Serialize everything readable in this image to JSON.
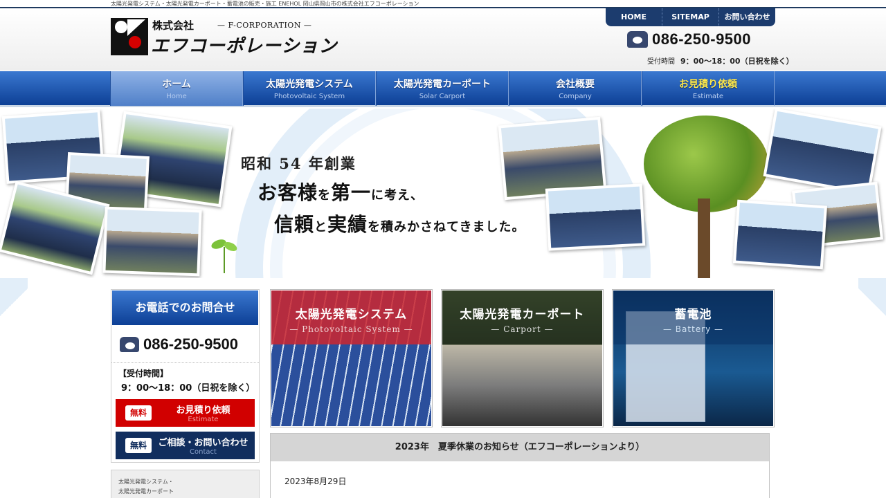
{
  "top_strip": {
    "text": "太陽光発電システム・太陽光発電カーポート・蓄電池の販売・施工 ENEHOL 岡山県岡山市の株式会社エフコーポレーション"
  },
  "header": {
    "logo_kabushiki": "株式会社",
    "logo_english": "— F-CORPORATION —",
    "logo_name": "エフコーポレーション",
    "utility_nav": [
      "HOME",
      "SITEMAP",
      "お問い合わせ"
    ],
    "phone": "086-250-9500",
    "hours_label": "受付時間",
    "hours": "9：00～18：00（日祝を除く）"
  },
  "nav": [
    {
      "jp": "ホーム",
      "en": "Home"
    },
    {
      "jp": "太陽光発電システム",
      "en": "Photovoltaic System"
    },
    {
      "jp": "太陽光発電カーポート",
      "en": "Solar Carport"
    },
    {
      "jp": "会社概要",
      "en": "Company"
    },
    {
      "jp": "お見積り依頼",
      "en": "Estimate"
    }
  ],
  "hero": {
    "line1": "昭和 54 年創業",
    "line2_a": "お客様",
    "line2_b": "を",
    "line2_c": "第一",
    "line2_d": "に考え、",
    "line3_a": "信頼",
    "line3_b": "と",
    "line3_c": "実績",
    "line3_d": "を積みかさねてきました。"
  },
  "sidebar": {
    "contact_title": "お電話でのお問合せ",
    "phone": "086-250-9500",
    "hours_label": "【受付時間】",
    "hours": "9：00～18：00（日祝を除く）",
    "estimate_badge": "無料",
    "estimate_jp": "お見積り依頼",
    "estimate_en": "Estimate",
    "contact_badge": "無料",
    "contact_jp": "ご相談・お問い合わせ",
    "contact_en": "Contact",
    "box2_line1": "太陽光発電システム・",
    "box2_line2": "太陽光発電カーポート"
  },
  "cards": [
    {
      "jp": "太陽光発電システム",
      "en": "— Photovoltaic System —"
    },
    {
      "jp": "太陽光発電カーポート",
      "en": "— Carport —"
    },
    {
      "jp": "蓄電池",
      "en": "— Battery —"
    }
  ],
  "news": {
    "title": "2023年　夏季休業のお知らせ（エフコーポレーションより）",
    "date": "2023年8月29日"
  },
  "colors": {
    "nav_blue": "#0d3f95",
    "accent_red": "#d10000",
    "navy": "#112e5e",
    "estimate_yellow": "#ffe94a"
  }
}
